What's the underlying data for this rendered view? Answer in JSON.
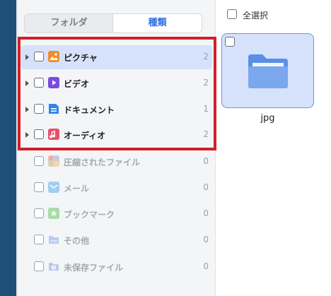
{
  "tabs": {
    "folder": "フォルダ",
    "type": "種類"
  },
  "categories": [
    {
      "label": "ピクチャ",
      "count": "2",
      "icon": "picture-icon",
      "color": "#f28c28"
    },
    {
      "label": "ビデオ",
      "count": "2",
      "icon": "video-icon",
      "color": "#7a4be0"
    },
    {
      "label": "ドキュメント",
      "count": "1",
      "icon": "document-icon",
      "color": "#2f86e8"
    },
    {
      "label": "オーディオ",
      "count": "2",
      "icon": "audio-icon",
      "color": "#e8506a"
    },
    {
      "label": "圧縮されたファイル",
      "count": "0",
      "icon": "archive-icon",
      "color": "#f0b8b0"
    },
    {
      "label": "メール",
      "count": "0",
      "icon": "mail-icon",
      "color": "#9fcff0"
    },
    {
      "label": "ブックマーク",
      "count": "0",
      "icon": "bookmark-icon",
      "color": "#a8dca8"
    },
    {
      "label": "その他",
      "count": "0",
      "icon": "other-icon",
      "color": "#b7cdf0"
    },
    {
      "label": "未保存ファイル",
      "count": "0",
      "icon": "unsaved-icon",
      "color": "#b7cdf0"
    }
  ],
  "content": {
    "select_all": "全選択",
    "files": [
      {
        "name": "jpg",
        "icon": "folder-icon"
      }
    ]
  }
}
